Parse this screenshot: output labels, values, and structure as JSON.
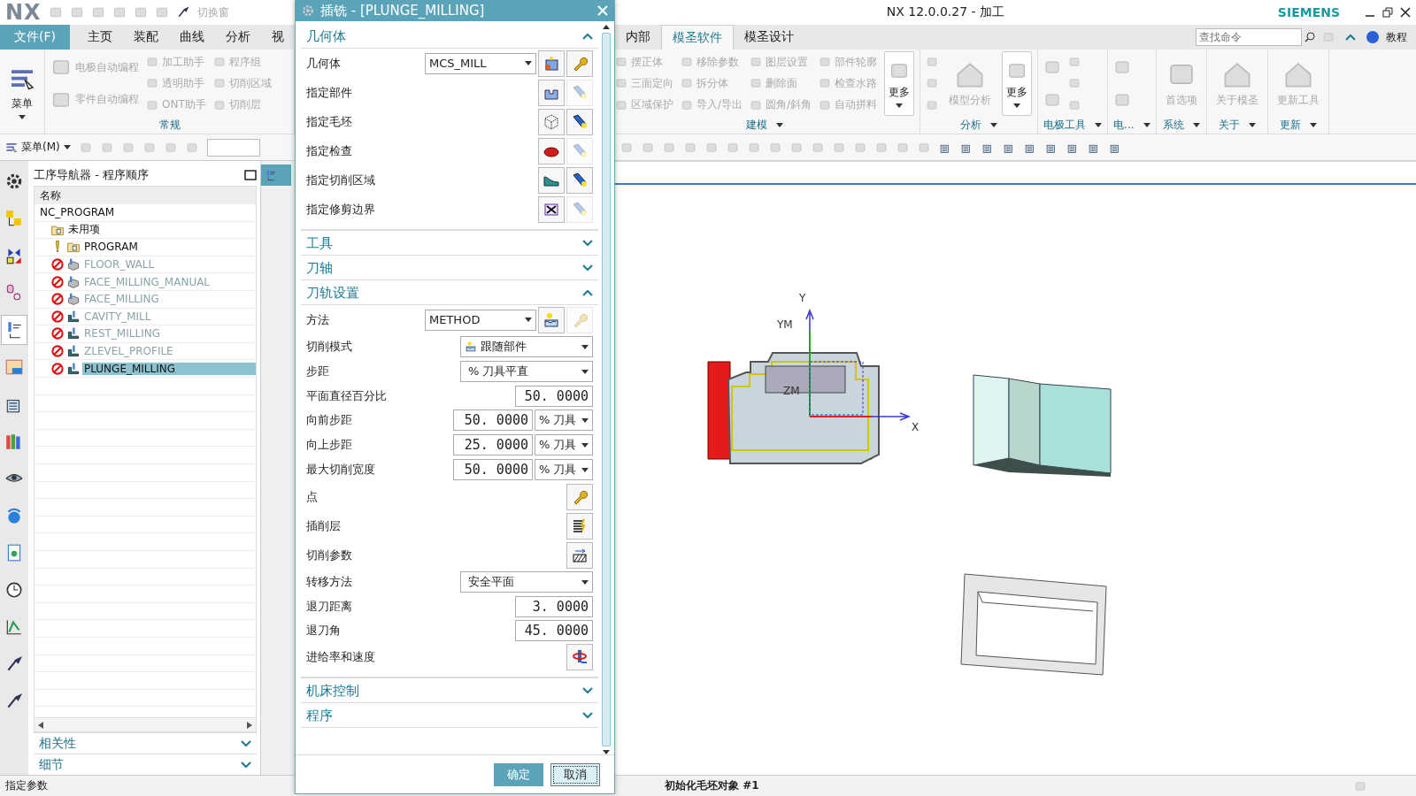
{
  "title_bar": {
    "logo": "NX",
    "switch_window": "切换窗",
    "title": "NX 12.0.0.27 - 加工",
    "brand": "SIEMENS"
  },
  "tabs_left": [
    {
      "label": "文件(F)",
      "kind": "file",
      "selected": false
    },
    {
      "label": "主页",
      "kind": "tab",
      "selected": false
    },
    {
      "label": "装配",
      "kind": "tab",
      "selected": false
    },
    {
      "label": "曲线",
      "kind": "tab",
      "selected": false
    },
    {
      "label": "分析",
      "kind": "tab",
      "selected": false
    },
    {
      "label": "视",
      "kind": "tab",
      "selected": false
    }
  ],
  "tabs_right": [
    {
      "label": "内部",
      "selected": false
    },
    {
      "label": "模圣软件",
      "selected": true
    },
    {
      "label": "模圣设计",
      "selected": false
    }
  ],
  "search": {
    "placeholder": "查找命令"
  },
  "help_link": "教程",
  "ribbon_left": {
    "menu": "菜单",
    "columns": [
      [
        {
          "label": "电极自动编程",
          "disabled": true
        },
        {
          "label": "零件自动编程",
          "disabled": true
        }
      ],
      [
        {
          "label": "加工助手",
          "disabled": true
        },
        {
          "label": "透明助手",
          "disabled": true
        },
        {
          "label": "ONT助手",
          "disabled": true
        }
      ],
      [
        {
          "label": "程序组",
          "disabled": true
        },
        {
          "label": "切削区域",
          "disabled": true
        },
        {
          "label": "切削层",
          "disabled": true
        }
      ]
    ],
    "group_label": "常规"
  },
  "ribbon_right": [
    {
      "kind": "columns",
      "label": "建模",
      "columns": [
        [
          {
            "label": "摆正体",
            "disabled": true
          },
          {
            "label": "三面定向",
            "disabled": true
          },
          {
            "label": "区域保护",
            "disabled": true
          }
        ],
        [
          {
            "label": "移除参数",
            "disabled": true
          },
          {
            "label": "拆分体",
            "disabled": true
          },
          {
            "label": "导入/导出",
            "disabled": true
          }
        ],
        [
          {
            "label": "图层设置",
            "disabled": true
          },
          {
            "label": "删除面",
            "disabled": true
          },
          {
            "label": "圆角/斜角",
            "disabled": true
          }
        ],
        [
          {
            "label": "部件轮廓",
            "disabled": true
          },
          {
            "label": "检查水路",
            "disabled": true
          },
          {
            "label": "自动拼料",
            "disabled": true
          }
        ]
      ],
      "more": "更多"
    },
    {
      "kind": "large",
      "label": "分析",
      "large": {
        "label": "模型分析",
        "disabled": true
      },
      "more": "更多"
    },
    {
      "kind": "icons",
      "label": "电极工具"
    },
    {
      "kind": "icons",
      "label": "电..."
    },
    {
      "kind": "large",
      "label": "系统",
      "large": {
        "label": "首选项",
        "disabled": true
      }
    },
    {
      "kind": "large",
      "label": "关于",
      "large": {
        "label": "关于模圣",
        "disabled": true
      }
    },
    {
      "kind": "large",
      "label": "更新",
      "large": {
        "label": "更新工具",
        "disabled": true
      }
    }
  ],
  "toolbar": {
    "menu": "菜单(M)"
  },
  "side_strip": [
    {
      "kind": "gear",
      "selected": false
    },
    {
      "kind": "program",
      "selected": false
    },
    {
      "kind": "machine",
      "selected": false
    },
    {
      "kind": "geometry",
      "selected": false
    },
    {
      "kind": "operation",
      "selected": true
    },
    {
      "kind": "table",
      "selected": false
    },
    {
      "kind": "library",
      "selected": false
    },
    {
      "kind": "books",
      "selected": false
    },
    {
      "kind": "eye",
      "selected": false
    },
    {
      "kind": "info",
      "selected": false
    },
    {
      "kind": "page",
      "selected": false
    },
    {
      "kind": "clock",
      "selected": false
    },
    {
      "kind": "palette",
      "selected": false
    },
    {
      "kind": "tool",
      "selected": false
    },
    {
      "kind": "tool",
      "selected": false
    }
  ],
  "navigator": {
    "title": "工序导航器 - 程序顺序",
    "column": "名称",
    "tree": [
      {
        "label": "NC_PROGRAM",
        "kind": "root",
        "dimmed": false,
        "selected": false,
        "children": [
          {
            "label": "未用项",
            "kind": "group",
            "warning": false,
            "blocked": false,
            "dimmed": false,
            "selected": false
          },
          {
            "label": "PROGRAM",
            "kind": "group",
            "warning": true,
            "blocked": false,
            "dimmed": false,
            "selected": false
          },
          {
            "label": "FLOOR_WALL",
            "kind": "face-op",
            "warning": false,
            "blocked": true,
            "dimmed": true,
            "selected": false
          },
          {
            "label": "FACE_MILLING_MANUAL",
            "kind": "face-op",
            "warning": false,
            "blocked": true,
            "dimmed": true,
            "selected": false
          },
          {
            "label": "FACE_MILLING",
            "kind": "face-op",
            "warning": false,
            "blocked": true,
            "dimmed": true,
            "selected": false
          },
          {
            "label": "CAVITY_MILL",
            "kind": "cavity-op",
            "warning": false,
            "blocked": true,
            "dimmed": true,
            "selected": false
          },
          {
            "label": "REST_MILLING",
            "kind": "cavity-op",
            "warning": false,
            "blocked": true,
            "dimmed": true,
            "selected": false
          },
          {
            "label": "ZLEVEL_PROFILE",
            "kind": "cavity-op",
            "warning": false,
            "blocked": true,
            "dimmed": true,
            "selected": false
          },
          {
            "label": "PLUNGE_MILLING",
            "kind": "cavity-op",
            "warning": false,
            "blocked": true,
            "dimmed": false,
            "selected": true
          }
        ]
      }
    ],
    "panels": [
      {
        "label": "相关性",
        "expanded": false
      },
      {
        "label": "细节",
        "expanded": false
      }
    ]
  },
  "dialog": {
    "title": "插铣 - [PLUNGE_MILLING]",
    "sections": [
      {
        "label": "几何体",
        "expanded": true,
        "rows": [
          {
            "kind": "select",
            "label": "几何体",
            "value": "MCS_MILL",
            "buttons": [
              {
                "kind": "new-geometry",
                "enabled": true
              },
              {
                "kind": "wrench",
                "enabled": true
              }
            ]
          },
          {
            "kind": "icons",
            "label": "指定部件",
            "buttons": [
              {
                "kind": "part",
                "enabled": true
              },
              {
                "kind": "flashlight",
                "enabled": false
              }
            ]
          },
          {
            "kind": "icons",
            "label": "指定毛坯",
            "buttons": [
              {
                "kind": "wire",
                "enabled": true
              },
              {
                "kind": "flashlight",
                "enabled": true
              }
            ]
          },
          {
            "kind": "icons",
            "label": "指定检查",
            "buttons": [
              {
                "kind": "check",
                "enabled": true
              },
              {
                "kind": "flashlight",
                "enabled": false
              }
            ]
          },
          {
            "kind": "icons",
            "label": "指定切削区域",
            "buttons": [
              {
                "kind": "surface",
                "enabled": true
              },
              {
                "kind": "flashlight",
                "enabled": true
              }
            ]
          },
          {
            "kind": "icons",
            "label": "指定修剪边界",
            "buttons": [
              {
                "kind": "trim",
                "enabled": true
              },
              {
                "kind": "flashlight",
                "enabled": false
              }
            ]
          }
        ]
      },
      {
        "label": "工具",
        "expanded": false
      },
      {
        "label": "刀轴",
        "expanded": false
      },
      {
        "label": "刀轨设置",
        "expanded": true,
        "rows": [
          {
            "kind": "select",
            "label": "方法",
            "value": "METHOD",
            "buttons": [
              {
                "kind": "method",
                "enabled": true
              },
              {
                "kind": "wrench",
                "enabled": false
              }
            ]
          },
          {
            "kind": "dropdown",
            "label": "切削模式",
            "value": "跟随部件",
            "icon": true
          },
          {
            "kind": "dropdown",
            "label": "步距",
            "value": "% 刀具平直",
            "icon": false
          },
          {
            "kind": "number",
            "label": "平面直径百分比",
            "value": "50. 0000"
          },
          {
            "kind": "number-unit",
            "label": "向前步距",
            "value": "50. 0000",
            "unit": "% 刀具"
          },
          {
            "kind": "number-unit",
            "label": "向上步距",
            "value": "25. 0000",
            "unit": "% 刀具"
          },
          {
            "kind": "number-unit",
            "label": "最大切削宽度",
            "value": "50. 0000",
            "unit": "% 刀具"
          },
          {
            "kind": "button",
            "label": "点",
            "buttons": [
              {
                "kind": "wrench",
                "enabled": true
              }
            ]
          },
          {
            "kind": "button",
            "label": "插削层",
            "buttons": [
              {
                "kind": "layers",
                "enabled": true
              }
            ]
          },
          {
            "kind": "button",
            "label": "切削参数",
            "buttons": [
              {
                "kind": "hatch",
                "enabled": true
              }
            ]
          },
          {
            "kind": "dropdown",
            "label": "转移方法",
            "value": "安全平面",
            "icon": false
          },
          {
            "kind": "number",
            "label": "退刀距离",
            "value": "3. 0000"
          },
          {
            "kind": "number",
            "label": "退刀角",
            "value": "45. 0000"
          },
          {
            "kind": "button",
            "label": "进给率和速度",
            "buttons": [
              {
                "kind": "feed",
                "enabled": true
              }
            ]
          }
        ]
      },
      {
        "label": "机床控制",
        "expanded": false
      },
      {
        "label": "程序",
        "expanded": false
      }
    ],
    "ok": "确定",
    "cancel": "取消"
  },
  "viewport": {
    "axis_labels": [
      "Y",
      "YM",
      "ZM",
      "X"
    ]
  },
  "status": {
    "left": "指定参数",
    "right": "初始化毛坯对象 #1"
  }
}
